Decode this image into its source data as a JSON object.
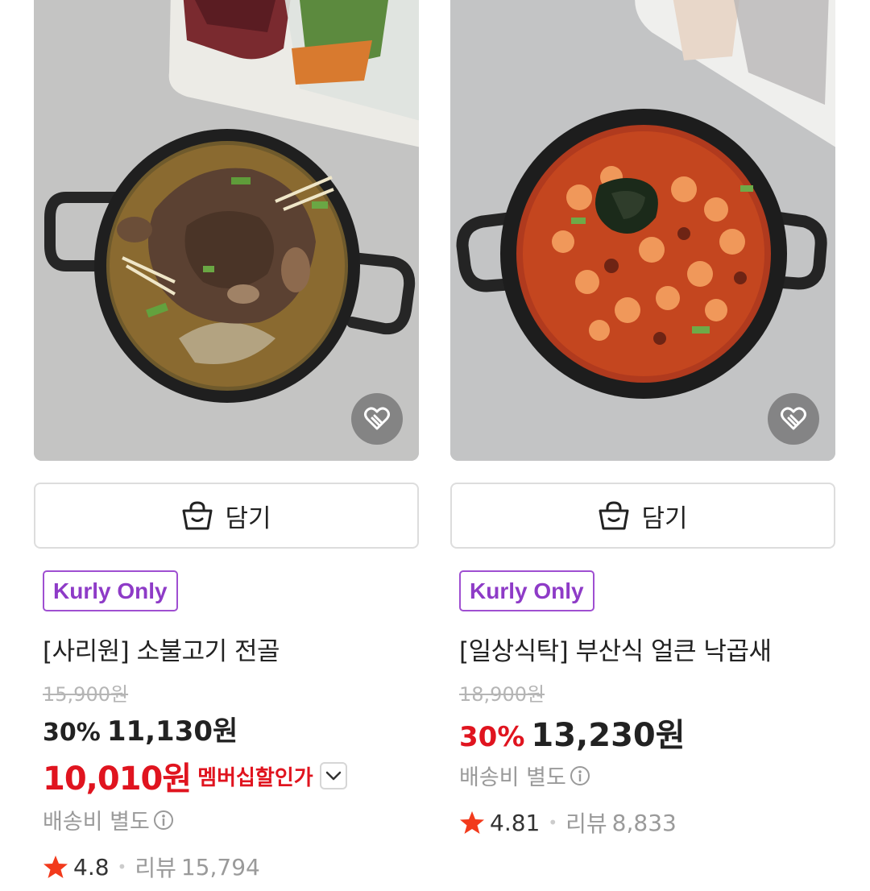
{
  "products": [
    {
      "image_alt": "소불고기 전골",
      "cart_label": "담기",
      "badge": "Kurly Only",
      "name": "[사리원] 소불고기 전골",
      "original_price": "15,900원",
      "discount_rate": "30%",
      "sale_price": "11,130원",
      "member_price": "10,010원",
      "member_label": "멤버십할인가",
      "shipping": "배송비 별도",
      "rating": "4.8",
      "review_label": "리뷰",
      "review_count": "15,794"
    },
    {
      "image_alt": "부산식 얼큰 낙곱새",
      "cart_label": "담기",
      "badge": "Kurly Only",
      "name": "[일상식탁] 부산식 얼큰 낙곱새",
      "original_price": "18,900원",
      "discount_rate": "30%",
      "sale_price": "13,230원",
      "shipping": "배송비 별도",
      "rating": "4.81",
      "review_label": "리뷰",
      "review_count": "8,833"
    }
  ],
  "colors": {
    "accent_red": "#e0141f",
    "kurly_purple": "#8e3bc7",
    "star": "#f23a1c"
  },
  "icons": [
    "heart-save-icon",
    "shopping-bag-icon",
    "chevron-down-icon",
    "info-icon",
    "star-icon"
  ]
}
